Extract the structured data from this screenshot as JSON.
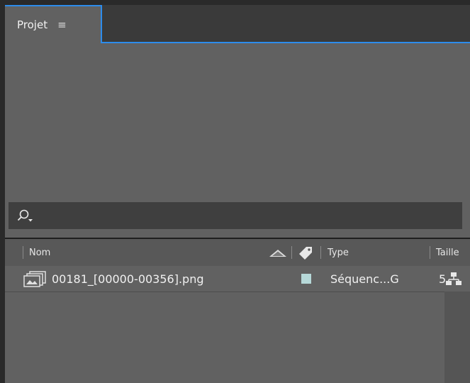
{
  "panel": {
    "tab_label": "Projet",
    "menu_icon_glyph": "≡"
  },
  "search": {
    "icon": "search-icon-with-dropdown"
  },
  "columns": {
    "name": "Nom",
    "type": "Type",
    "size": "Taille"
  },
  "items": [
    {
      "name": "00181_[00000-00356].png",
      "label_color": "#b6d8d8",
      "type": "Séquenc...G",
      "size": "5"
    }
  ],
  "colors": {
    "accent": "#2d8ceb",
    "panel_bg": "#616161",
    "header_bg": "#585858"
  }
}
